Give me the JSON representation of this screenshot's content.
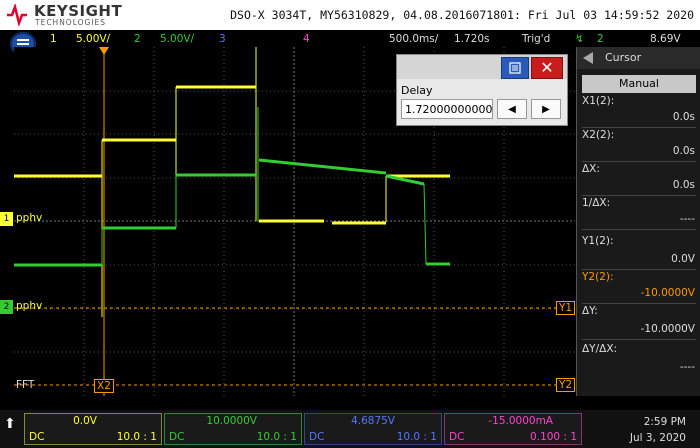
{
  "header": {
    "brand": "KEYSIGHT",
    "brand_sub": "TECHNOLOGIES",
    "model_line": "DSO-X 3034T, MY56310829, 04.08.2016071801: Fri Jul 03 14:59:52 2020"
  },
  "channel_bar": {
    "ch1_num": "1",
    "ch1_scale": "5.00V/",
    "ch2_num": "2",
    "ch2_scale": "5.00V/",
    "ch3_num": "3",
    "ch4_num": "4",
    "timebase": "500.0ms/",
    "delay": "1.720s",
    "trig_label": "Trig'd",
    "trig_ch": "2",
    "trig_level": "8.69V"
  },
  "graticule_labels": {
    "ch1_marker": "1",
    "ch1_label": "pphv",
    "ch2_marker": "2",
    "ch2_label": "pphv",
    "fft_label": "FFT",
    "x2_label": "X2",
    "y1_label": "Y1",
    "y2_label": "Y2"
  },
  "delay_dialog": {
    "title": "Delay",
    "value": "1.72000000000000s",
    "close": "✕",
    "left_arrow": "◀",
    "right_arrow": "▶"
  },
  "cursor_panel": {
    "title": "Cursor",
    "mode": "Manual",
    "x1_label": "X1(2):",
    "x1_value": "0.0s",
    "x2_label": "X2(2):",
    "x2_value": "0.0s",
    "dx_label": "ΔX:",
    "dx_value": "0.0s",
    "inv_dx_label": "1/ΔX:",
    "inv_dx_value": "----",
    "y1_label": "Y1(2):",
    "y1_value": "0.0V",
    "y2_label": "Y2(2):",
    "y2_value": "-10.0000V",
    "dy_label": "ΔY:",
    "dy_value": "-10.0000V",
    "dydx_label": "ΔY/ΔX:",
    "dydx_value": "----"
  },
  "bottom_bar": {
    "up_arrow": "⬆",
    "ch1": {
      "value": "0.0V",
      "coupling": "DC",
      "probe": "10.0 : 1"
    },
    "ch2": {
      "value": "10.0000V",
      "coupling": "DC",
      "probe": "10.0 : 1"
    },
    "ch3": {
      "value": "4.6875V",
      "coupling": "DC",
      "probe": "10.0 : 1"
    },
    "ch4": {
      "value": "-15.0000mA",
      "coupling": "DC",
      "probe": "0.100 : 1"
    },
    "time": "2:59 PM",
    "date": "Jul 3, 2020"
  },
  "colors": {
    "ch1": "#ffff33",
    "ch2": "#33cc33",
    "ch3": "#5577ff",
    "ch4": "#ff44cc",
    "cursor": "#ff9900",
    "accent": "#1e4fa6"
  }
}
